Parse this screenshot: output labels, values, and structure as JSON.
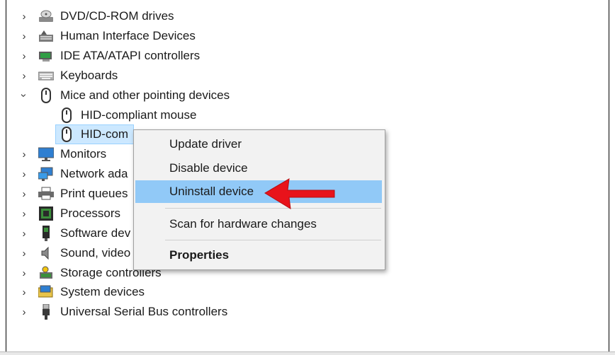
{
  "tree": {
    "items": [
      {
        "label": "DVD/CD-ROM drives",
        "icon": "dvd-drive-icon",
        "expanded": false
      },
      {
        "label": "Human Interface Devices",
        "icon": "human-interface-device-icon",
        "expanded": false
      },
      {
        "label": "IDE ATA/ATAPI controllers",
        "icon": "ide-controller-icon",
        "expanded": false
      },
      {
        "label": "Keyboards",
        "icon": "keyboard-icon",
        "expanded": false
      },
      {
        "label": "Mice and other pointing devices",
        "icon": "mouse-icon",
        "expanded": true
      },
      {
        "label": "Monitors",
        "icon": "monitor-icon",
        "expanded": false
      },
      {
        "label": "Network ada",
        "icon": "network-adapter-icon",
        "expanded": false
      },
      {
        "label": "Print queues",
        "icon": "printer-icon",
        "expanded": false
      },
      {
        "label": "Processors",
        "icon": "processor-icon",
        "expanded": false
      },
      {
        "label": "Software dev",
        "icon": "software-device-icon",
        "expanded": false
      },
      {
        "label": "Sound, video",
        "icon": "speaker-icon",
        "expanded": false
      },
      {
        "label": "Storage controllers",
        "icon": "storage-controller-icon",
        "expanded": false
      },
      {
        "label": "System devices",
        "icon": "system-devices-icon",
        "expanded": false
      },
      {
        "label": "Universal Serial Bus controllers",
        "icon": "usb-icon",
        "expanded": false
      }
    ],
    "children": [
      {
        "label": "HID-compliant mouse",
        "icon": "mouse-icon"
      },
      {
        "label": "HID-com",
        "icon": "mouse-icon",
        "selected": true
      }
    ]
  },
  "context_menu": {
    "items": [
      {
        "label": "Update driver"
      },
      {
        "label": "Disable device"
      },
      {
        "label": "Uninstall device",
        "highlighted": true
      },
      {
        "label": "Scan for hardware changes"
      },
      {
        "label": "Properties",
        "bold": true
      }
    ]
  },
  "colors": {
    "selection": "#cce8ff",
    "menu_highlight": "#91c9f7",
    "arrow": "#e8131b"
  }
}
